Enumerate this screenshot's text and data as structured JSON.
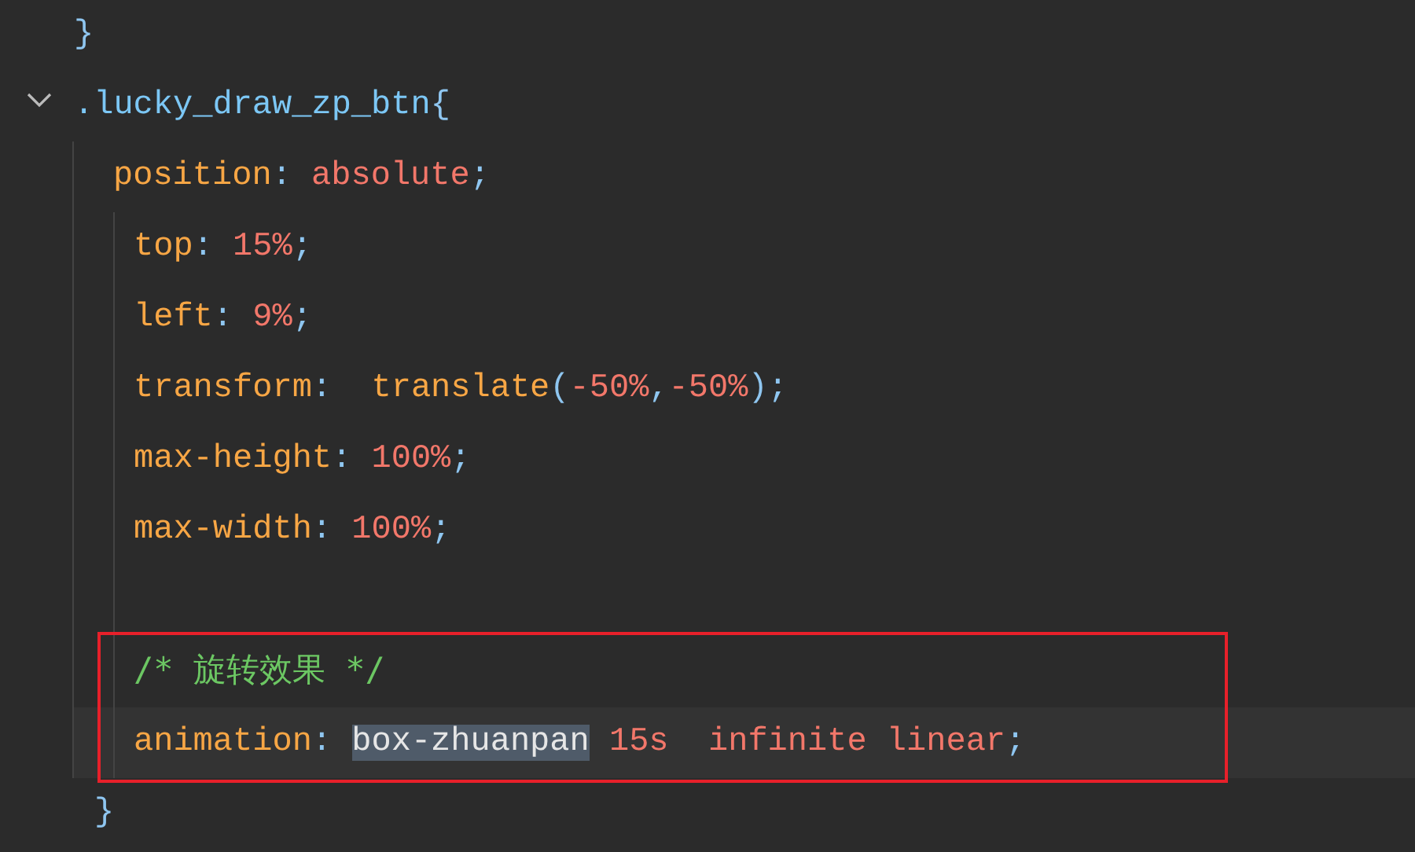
{
  "lines": [
    {
      "kind": "top",
      "fold": false,
      "current": false,
      "boxed": false,
      "tokens": [
        {
          "text": "}",
          "kind": "punct"
        }
      ]
    },
    {
      "kind": "top",
      "fold": true,
      "current": false,
      "boxed": false,
      "tokens": [
        {
          "text": ".lucky_draw_zp_btn",
          "kind": "selector"
        },
        {
          "text": "{",
          "kind": "punct"
        }
      ]
    },
    {
      "kind": "decl",
      "fold": false,
      "current": false,
      "boxed": false,
      "tokens": [
        {
          "text": "position",
          "kind": "property"
        },
        {
          "text": ": ",
          "kind": "punct"
        },
        {
          "text": "absolute",
          "kind": "value"
        },
        {
          "text": ";",
          "kind": "punct"
        }
      ]
    },
    {
      "kind": "nested",
      "fold": false,
      "current": false,
      "boxed": false,
      "tokens": [
        {
          "text": "top",
          "kind": "property"
        },
        {
          "text": ": ",
          "kind": "punct"
        },
        {
          "text": "15%",
          "kind": "value"
        },
        {
          "text": ";",
          "kind": "punct"
        }
      ]
    },
    {
      "kind": "nested",
      "fold": false,
      "current": false,
      "boxed": false,
      "tokens": [
        {
          "text": "left",
          "kind": "property"
        },
        {
          "text": ": ",
          "kind": "punct"
        },
        {
          "text": "9%",
          "kind": "value"
        },
        {
          "text": ";",
          "kind": "punct"
        }
      ]
    },
    {
      "kind": "nested",
      "fold": false,
      "current": false,
      "boxed": false,
      "tokens": [
        {
          "text": "transform",
          "kind": "property"
        },
        {
          "text": ":  ",
          "kind": "punct"
        },
        {
          "text": "translate",
          "kind": "property"
        },
        {
          "text": "(",
          "kind": "punct"
        },
        {
          "text": "-50%",
          "kind": "value"
        },
        {
          "text": ",",
          "kind": "punct"
        },
        {
          "text": "-50%",
          "kind": "value"
        },
        {
          "text": ");",
          "kind": "punct"
        }
      ]
    },
    {
      "kind": "nested",
      "fold": false,
      "current": false,
      "boxed": false,
      "tokens": [
        {
          "text": "max-height",
          "kind": "property"
        },
        {
          "text": ": ",
          "kind": "punct"
        },
        {
          "text": "100%",
          "kind": "value"
        },
        {
          "text": ";",
          "kind": "punct"
        }
      ]
    },
    {
      "kind": "nested",
      "fold": false,
      "current": false,
      "boxed": false,
      "tokens": [
        {
          "text": "max-width",
          "kind": "property"
        },
        {
          "text": ": ",
          "kind": "punct"
        },
        {
          "text": "100%",
          "kind": "value"
        },
        {
          "text": ";",
          "kind": "punct"
        }
      ]
    },
    {
      "kind": "nested",
      "fold": false,
      "current": false,
      "boxed": false
    },
    {
      "kind": "nested",
      "fold": false,
      "current": false,
      "boxed": true,
      "tokens": [
        {
          "text": "/* 旋转效果 */",
          "kind": "comment"
        }
      ]
    },
    {
      "kind": "nested",
      "fold": false,
      "current": true,
      "boxed": true,
      "tokens": [
        {
          "text": "animation",
          "kind": "property"
        },
        {
          "text": ": ",
          "kind": "punct"
        },
        {
          "text": "box-zhuanpan",
          "kind": "selected"
        },
        {
          "text": " 15s",
          "kind": "value"
        },
        {
          "text": "  infinite linear",
          "kind": "value"
        },
        {
          "text": ";",
          "kind": "punct"
        }
      ]
    },
    {
      "kind": "close",
      "fold": false,
      "current": false,
      "boxed": false,
      "tokens": [
        {
          "text": "}",
          "kind": "punct"
        }
      ]
    }
  ]
}
